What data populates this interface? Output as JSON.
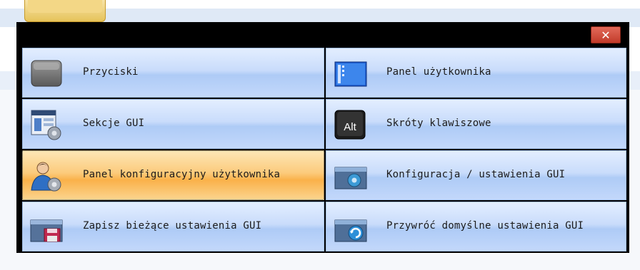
{
  "dialog": {
    "close_glyph": "✕",
    "items": [
      {
        "label": "Przyciski",
        "icon": "button-icon"
      },
      {
        "label": "Panel użytkownika",
        "icon": "user-panel-icon"
      },
      {
        "label": "Sekcje GUI",
        "icon": "gui-sections-icon"
      },
      {
        "label": "Skróty klawiszowe",
        "icon": "alt-key-icon",
        "icon_text": "Alt"
      },
      {
        "label": "Panel konfiguracyjny użytkownika",
        "icon": "user-config-icon",
        "selected": true
      },
      {
        "label": "Konfiguracja / ustawienia GUI",
        "icon": "gui-settings-icon"
      },
      {
        "label": "Zapisz bieżące ustawienia GUI",
        "icon": "save-settings-icon"
      },
      {
        "label": "Przywróć domyślne ustawienia GUI",
        "icon": "restore-defaults-icon"
      }
    ]
  },
  "colors": {
    "tile": "#c9dcfb",
    "tile_selected": "#fab14a",
    "titlebar": "#000000",
    "close": "#c23b2a"
  }
}
